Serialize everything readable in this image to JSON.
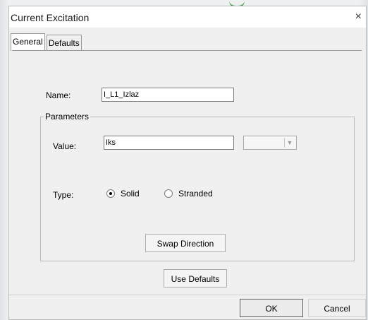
{
  "dialog": {
    "title": "Current Excitation",
    "close_glyph": "×",
    "tabs": [
      {
        "label": "General",
        "active": true
      },
      {
        "label": "Defaults",
        "active": false
      }
    ],
    "name": {
      "label": "Name:",
      "value": "I_L1_Izlaz"
    },
    "parameters": {
      "legend": "Parameters",
      "value_label": "Value:",
      "value": "Iks",
      "unit_select_value": "",
      "type_label": "Type:",
      "type_options": [
        {
          "label": "Solid",
          "checked": true
        },
        {
          "label": "Stranded",
          "checked": false
        }
      ],
      "swap_button": "Swap Direction"
    },
    "use_defaults_button": "Use Defaults",
    "ok_button": "OK",
    "cancel_button": "Cancel"
  }
}
